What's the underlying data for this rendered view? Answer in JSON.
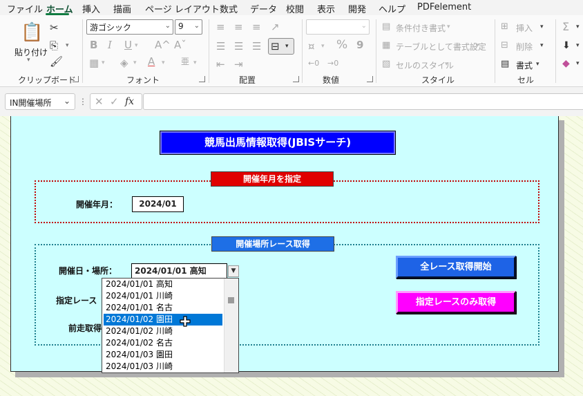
{
  "menu": {
    "items": [
      "ファイル",
      "ホーム",
      "挿入",
      "描画",
      "ページ レイアウト",
      "数式",
      "データ",
      "校閲",
      "表示",
      "開発",
      "ヘルプ",
      "PDFelement"
    ],
    "active": "ホーム"
  },
  "ribbon": {
    "clipboard": {
      "paste_label": "貼り付け",
      "group_label": "クリップボード"
    },
    "font": {
      "font_name": "游ゴシック",
      "font_size": "9",
      "group_label": "フォント",
      "bold": "B",
      "italic": "I",
      "underline": "U",
      "grow": "A^",
      "shrink": "Aˇ",
      "font_color_glyph": "A",
      "phonetic_glyph": "亜"
    },
    "alignment": {
      "group_label": "配置"
    },
    "number": {
      "format_value": "",
      "group_label": "数値",
      "percent": "%",
      "comma": "9"
    },
    "styles": {
      "conditional": "条件付き書式",
      "table": "テーブルとして書式設定",
      "cell_styles": "セルのスタイル",
      "group_label": "スタイル"
    },
    "cells": {
      "insert": "挿入",
      "delete": "削除",
      "format": "書式",
      "group_label": "セル"
    },
    "editing": {
      "sum": "Σ"
    }
  },
  "formula_bar": {
    "name_box": "IN開催場所",
    "fx": "fx",
    "formula": ""
  },
  "form": {
    "title": "競馬出馬情報取得(JBISサーチ)",
    "section1": {
      "label": "開催年月を指定",
      "field_label": "開催年月：",
      "value": "2024/01"
    },
    "section2": {
      "label": "開催場所レース取得",
      "date_place_label": "開催日・場所：",
      "date_place_value": "2024/01/01 高知",
      "race_label_partial": "指定レース",
      "prev_label_partial": "前走取得",
      "dropdown_items": [
        "2024/01/01 高知",
        "2024/01/01 川崎",
        "2024/01/01 名古",
        "2024/01/02 園田",
        "2024/01/02 川崎",
        "2024/01/02 名古",
        "2024/01/03 園田",
        "2024/01/03 川崎"
      ],
      "selected_index": 3
    },
    "buttons": {
      "all_races": "全レース取得開始",
      "selected_races": "指定レースのみ取得"
    }
  },
  "colors": {
    "panel": "#ccffff",
    "title_bg": "#0000ff",
    "section1_bg": "#e00000",
    "section2_bg": "#1e6fe6",
    "btn_all": "#1e63e6",
    "btn_selected": "#ff00ff",
    "selection": "#0078d7",
    "excel_green": "#107c41"
  }
}
